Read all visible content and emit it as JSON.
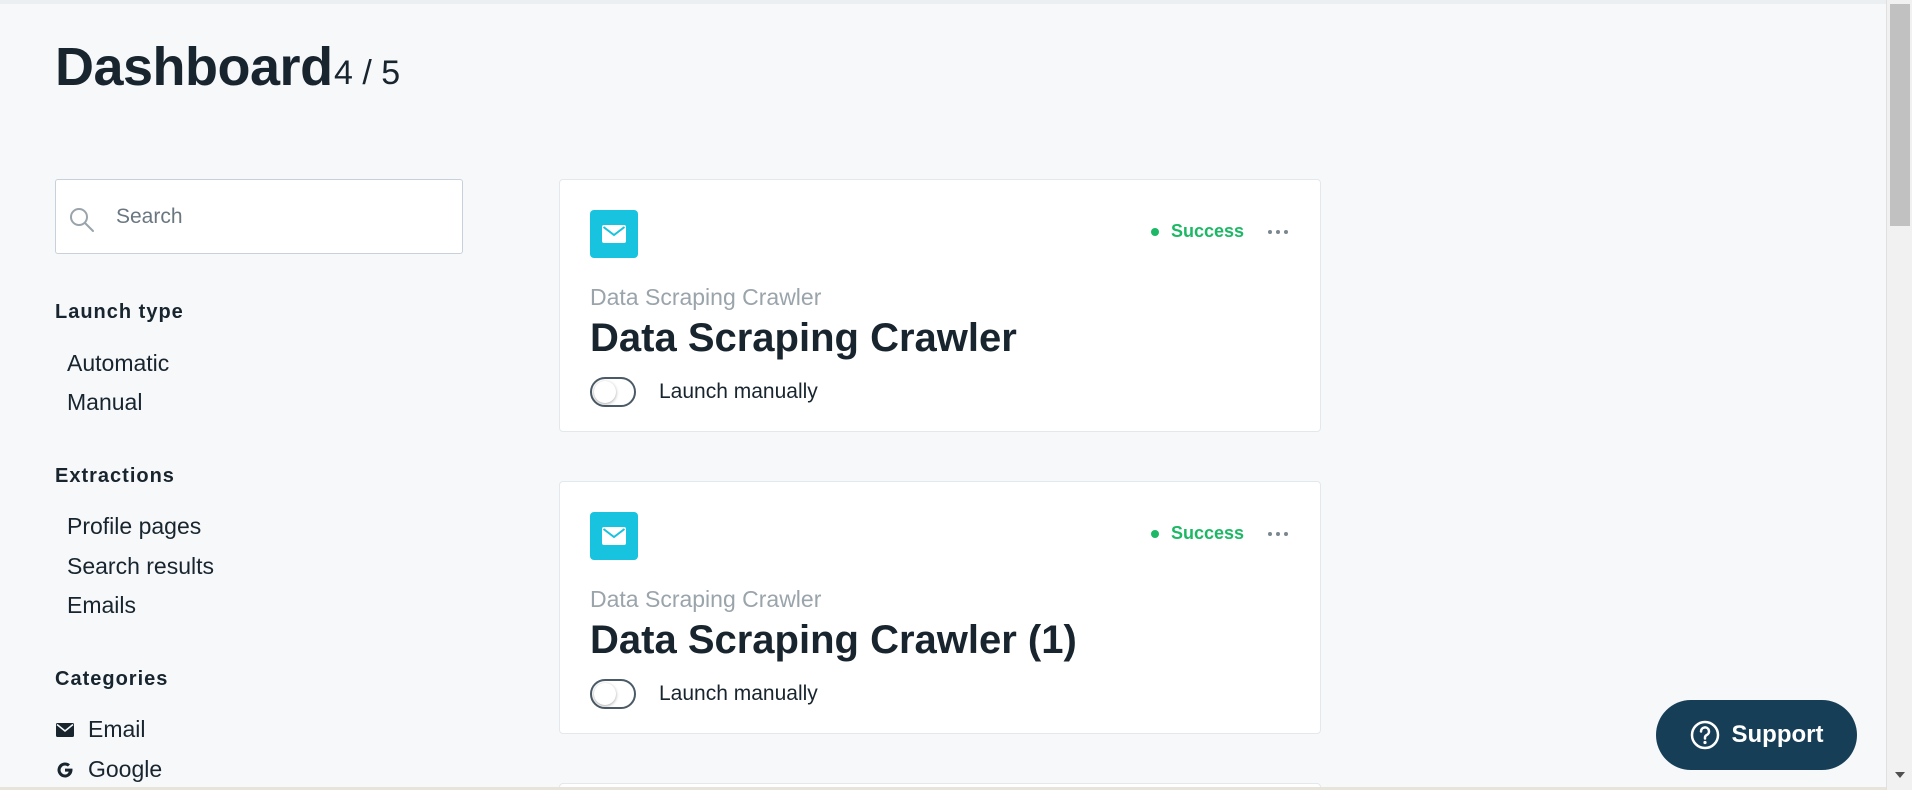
{
  "header": {
    "title": "Dashboard",
    "count": "4 / 5"
  },
  "search": {
    "placeholder": "Search",
    "value": ""
  },
  "filters": {
    "launch_type": {
      "heading": "Launch type",
      "items": [
        "Automatic",
        "Manual"
      ]
    },
    "extractions": {
      "heading": "Extractions",
      "items": [
        "Profile pages",
        "Search results",
        "Emails"
      ]
    },
    "categories": {
      "heading": "Categories",
      "items": [
        {
          "label": "Email",
          "icon": "envelope-icon"
        },
        {
          "label": "Google",
          "icon": "google-icon"
        }
      ]
    }
  },
  "cards": [
    {
      "icon": "envelope-icon",
      "status": "Success",
      "subtitle": "Data Scraping Crawler",
      "title": "Data Scraping Crawler",
      "toggle_label": "Launch manually",
      "toggle_on": false
    },
    {
      "icon": "envelope-icon",
      "status": "Success",
      "subtitle": "Data Scraping Crawler",
      "title": "Data Scraping Crawler (1)",
      "toggle_label": "Launch manually",
      "toggle_on": false
    }
  ],
  "support": {
    "label": "Support",
    "icon": "question-circle-icon"
  },
  "colors": {
    "accent_cyan": "#17c3de",
    "success_green": "#1db865",
    "support_navy": "#173e57",
    "text_dark": "#18252e",
    "text_muted": "#9aa4ab",
    "background": "#f6f8fa"
  }
}
